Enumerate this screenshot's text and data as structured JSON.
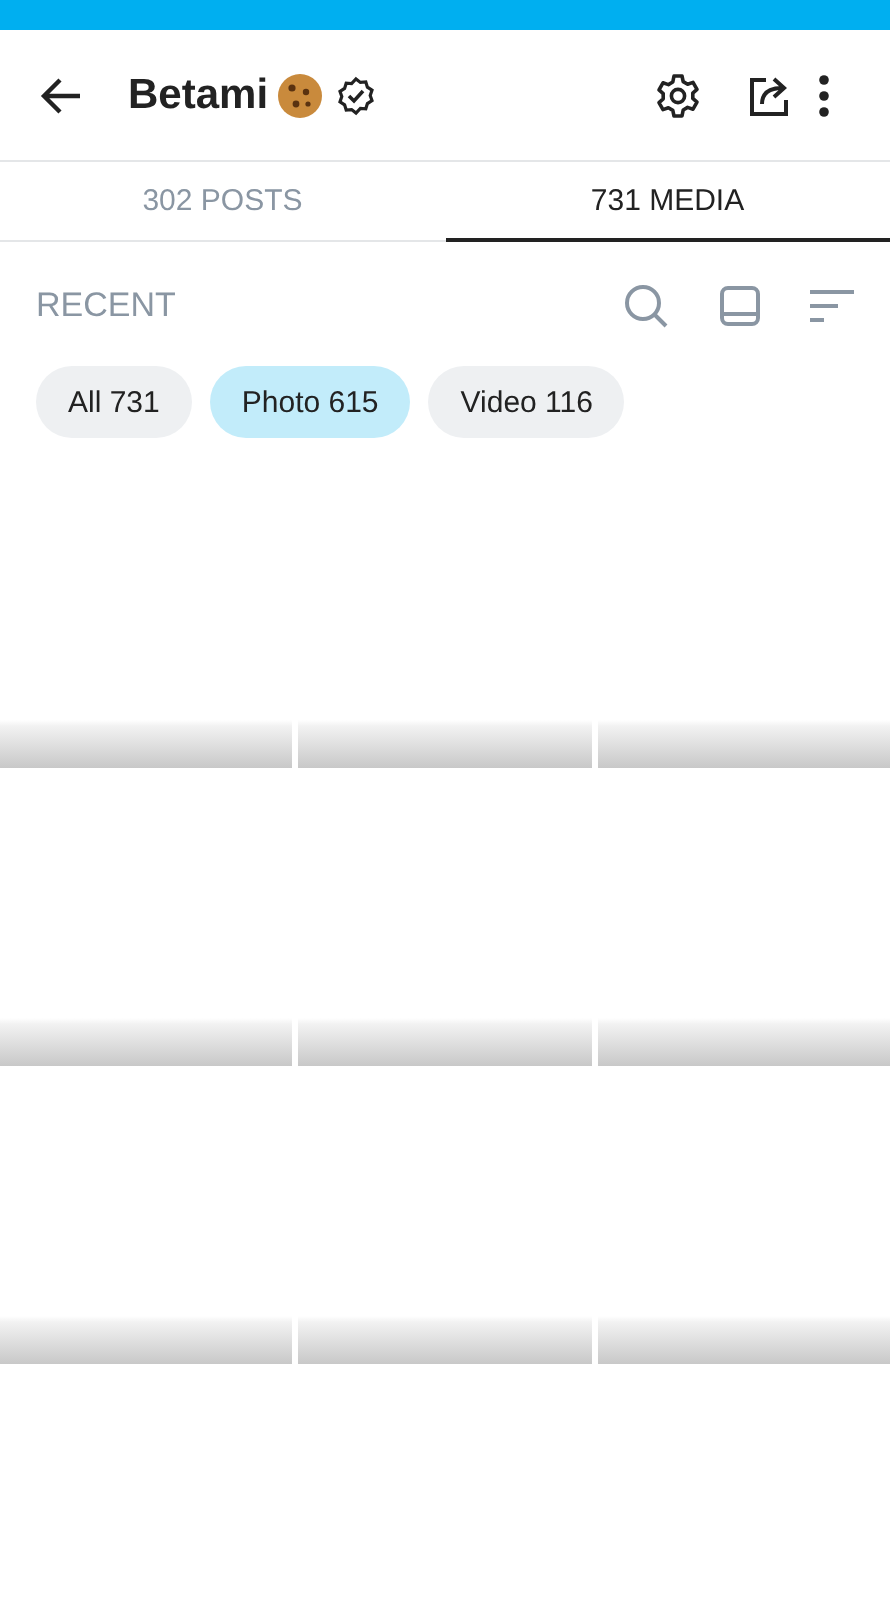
{
  "header": {
    "title": "Betami",
    "verified": true
  },
  "tabs": [
    {
      "label": "302 POSTS",
      "selected": false
    },
    {
      "label": "731 MEDIA",
      "selected": true
    }
  ],
  "section": {
    "title": "RECENT"
  },
  "filters": [
    {
      "label": "All 731",
      "selected": false
    },
    {
      "label": "Photo 615",
      "selected": true
    },
    {
      "label": "Video 116",
      "selected": false
    }
  ],
  "media": [
    {
      "kind": "placeholder"
    },
    {
      "kind": "placeholder"
    },
    {
      "kind": "placeholder"
    },
    {
      "kind": "placeholder"
    },
    {
      "kind": "placeholder"
    },
    {
      "kind": "placeholder"
    },
    {
      "kind": "placeholder"
    },
    {
      "kind": "placeholder"
    },
    {
      "kind": "placeholder"
    }
  ]
}
